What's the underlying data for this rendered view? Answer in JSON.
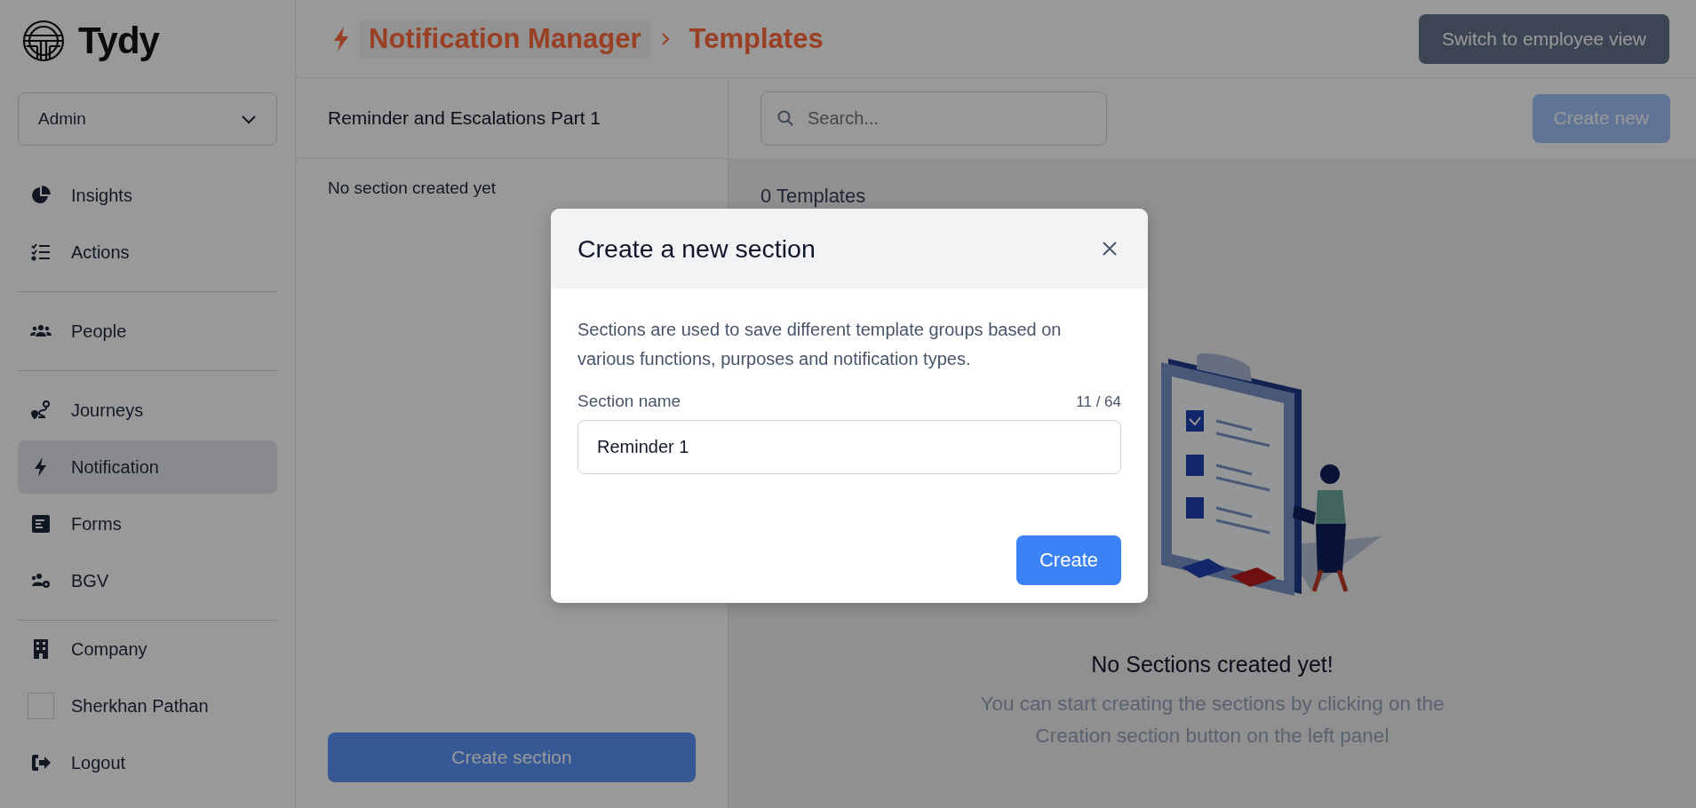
{
  "logo": {
    "text": "Tydy"
  },
  "role_select": {
    "value": "Admin"
  },
  "sidebar": {
    "groups": [
      [
        {
          "label": "Insights",
          "selected": false
        },
        {
          "label": "Actions",
          "selected": false
        }
      ],
      [
        {
          "label": "People",
          "selected": false
        }
      ],
      [
        {
          "label": "Journeys",
          "selected": false
        },
        {
          "label": "Notification",
          "selected": true
        },
        {
          "label": "Forms",
          "selected": false
        },
        {
          "label": "BGV",
          "selected": false
        }
      ],
      [
        {
          "label": "Company",
          "selected": false
        },
        {
          "label": "Sherkhan Pathan",
          "selected": false
        },
        {
          "label": "Logout",
          "selected": false
        }
      ]
    ]
  },
  "header": {
    "breadcrumb": [
      {
        "label": "Notification Manager"
      },
      {
        "label": "Templates"
      }
    ],
    "switch_button": "Switch to employee view"
  },
  "sections_panel": {
    "title": "Reminder and Escalations Part 1",
    "empty_text": "No section created yet",
    "create_button": "Create section"
  },
  "templates_panel": {
    "search": {
      "placeholder": "Search..."
    },
    "create_button": {
      "label": "Create new",
      "disabled": true
    },
    "count": "0 Templates",
    "empty_title": "No Sections created yet!",
    "empty_text": "You can start creating the sections by clicking on the Creation section button on the left panel"
  },
  "modal": {
    "title": "Create a new section",
    "description": "Sections are used to save different template groups based on various functions, purposes and notification types.",
    "field": {
      "label": "Section name",
      "counter": "11 / 64",
      "value": "Reminder 1"
    },
    "submit": "Create"
  }
}
